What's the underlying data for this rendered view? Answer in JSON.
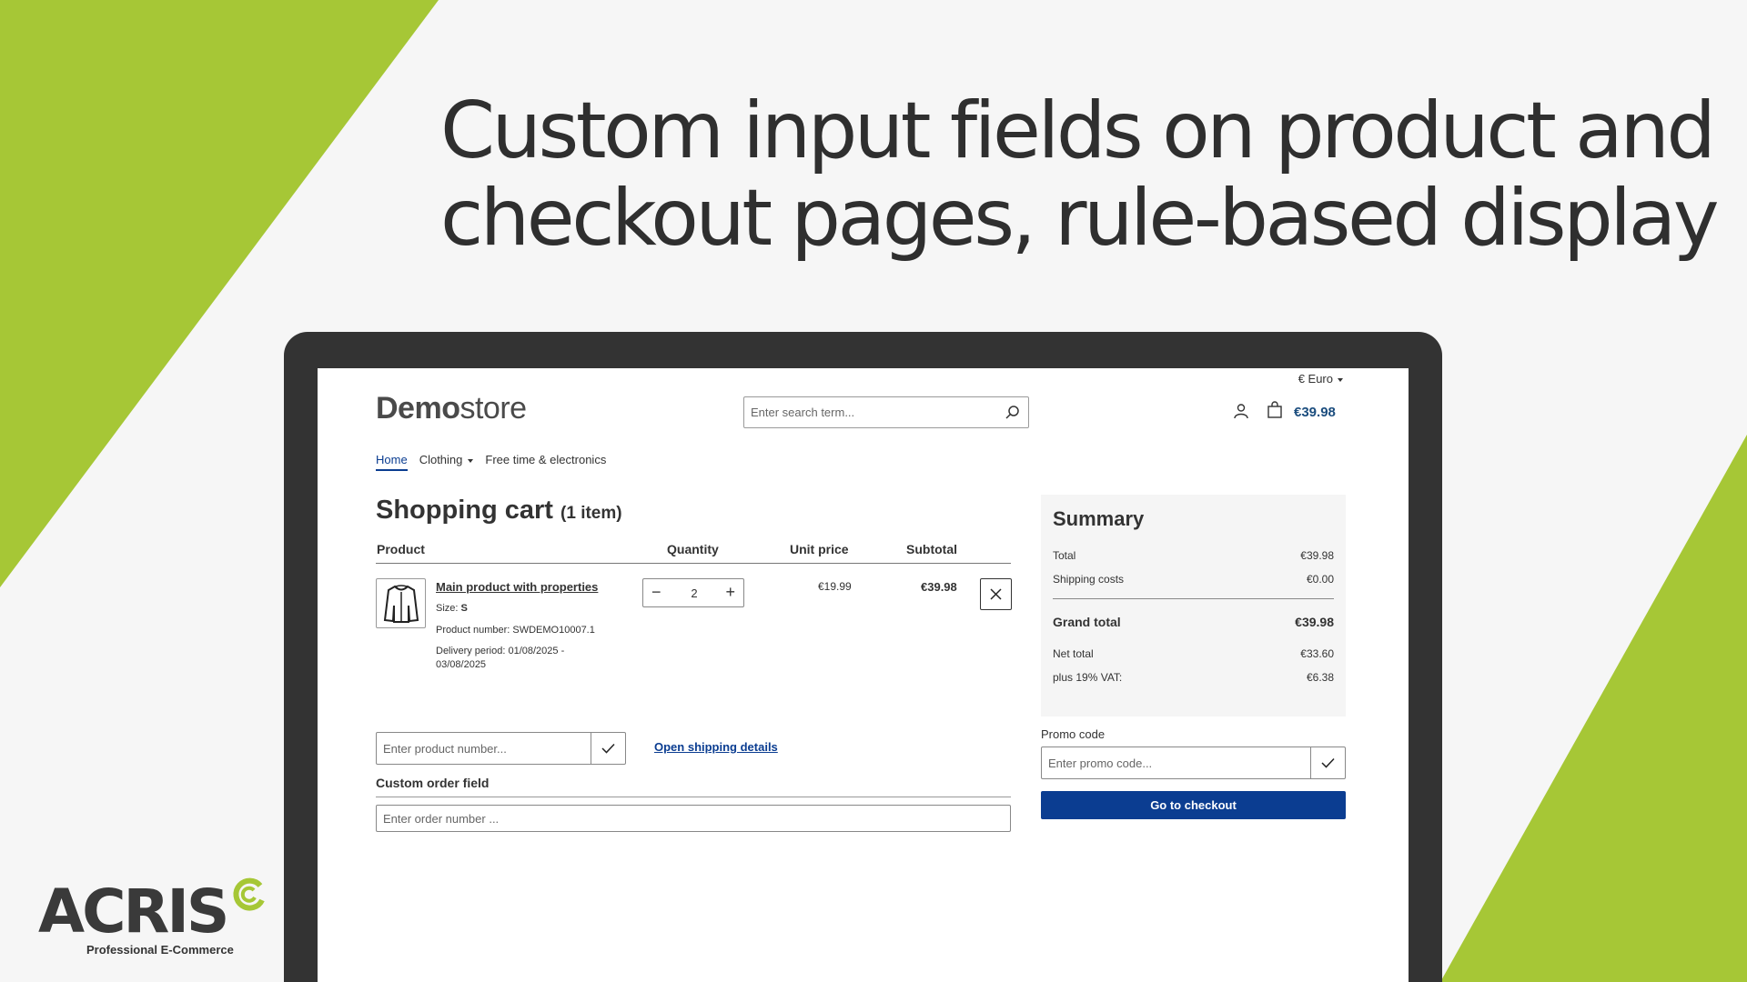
{
  "headline": {
    "line1": "Custom input fields on product and",
    "line2": "checkout pages, rule-based display"
  },
  "colors": {
    "accent_green": "#a6c736",
    "laptop_frame": "#333333",
    "primary_blue": "#0b3d91",
    "price_blue": "#1b4d7e"
  },
  "store": {
    "currency": "€ Euro",
    "logo_bold": "Demo",
    "logo_light": "store",
    "search_placeholder": "Enter search term...",
    "cart_total": "€39.98",
    "nav": [
      {
        "label": "Home",
        "active": true
      },
      {
        "label": "Clothing",
        "dropdown": true
      },
      {
        "label": "Free time & electronics"
      }
    ]
  },
  "cart": {
    "title": "Shopping cart",
    "count": "(1 item)",
    "columns": {
      "product": "Product",
      "quantity": "Quantity",
      "unit_price": "Unit price",
      "subtotal": "Subtotal"
    },
    "item": {
      "icon": "shirt-icon",
      "name": "Main product with properties",
      "size_label": "Size:",
      "size_value": "S",
      "product_number": "Product number: SWDEMO10007.1",
      "delivery_line1": "Delivery period: 01/08/2025 -",
      "delivery_line2": "03/08/2025",
      "quantity": "2",
      "unit_price": "€19.99",
      "subtotal": "€39.98"
    },
    "product_number_placeholder": "Enter product number...",
    "shipping_link": "Open shipping details",
    "custom_field_label": "Custom order field",
    "custom_field_placeholder": "Enter order number ..."
  },
  "summary": {
    "title": "Summary",
    "rows": [
      {
        "label": "Total",
        "value": "€39.98"
      },
      {
        "label": "Shipping costs",
        "value": "€0.00"
      }
    ],
    "grand": {
      "label": "Grand total",
      "value": "€39.98"
    },
    "net": [
      {
        "label": "Net total",
        "value": "€33.60"
      },
      {
        "label": "plus 19% VAT:",
        "value": "€6.38"
      }
    ],
    "promo_label": "Promo code",
    "promo_placeholder": "Enter promo code...",
    "checkout_label": "Go to checkout"
  },
  "brand": {
    "name": "ACRIS",
    "tagline": "Professional E-Commerce"
  }
}
